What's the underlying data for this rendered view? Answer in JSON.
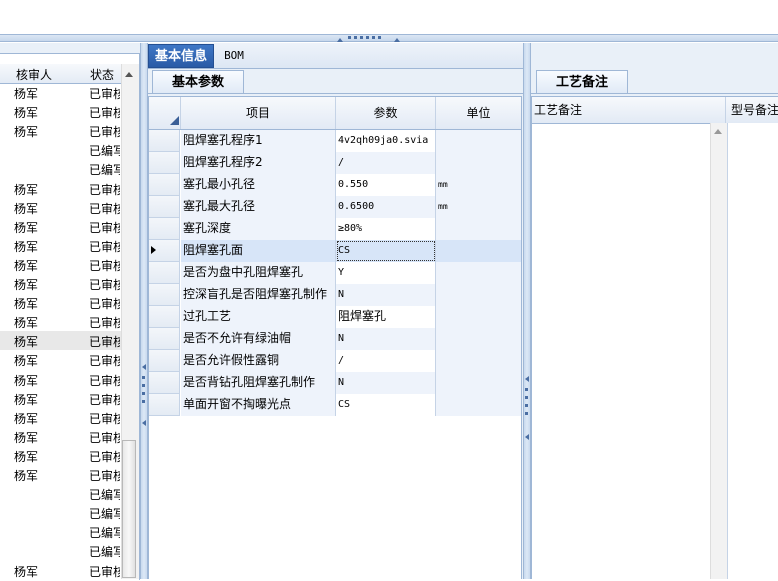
{
  "left_grid": {
    "headers": [
      "核审人",
      "状态"
    ],
    "rows": [
      {
        "reviewer": "杨军",
        "status": "已审核"
      },
      {
        "reviewer": "杨军",
        "status": "已审核"
      },
      {
        "reviewer": "杨军",
        "status": "已审核"
      },
      {
        "reviewer": "",
        "status": "已编写"
      },
      {
        "reviewer": "",
        "status": "已编写"
      },
      {
        "reviewer": "杨军",
        "status": "已审核"
      },
      {
        "reviewer": "杨军",
        "status": "已审核"
      },
      {
        "reviewer": "杨军",
        "status": "已审核"
      },
      {
        "reviewer": "杨军",
        "status": "已审核"
      },
      {
        "reviewer": "杨军",
        "status": "已审核"
      },
      {
        "reviewer": "杨军",
        "status": "已审核"
      },
      {
        "reviewer": "杨军",
        "status": "已审核"
      },
      {
        "reviewer": "杨军",
        "status": "已审核"
      },
      {
        "reviewer": "杨军",
        "status": "已审核"
      },
      {
        "reviewer": "杨军",
        "status": "已审核"
      },
      {
        "reviewer": "杨军",
        "status": "已审核"
      },
      {
        "reviewer": "杨军",
        "status": "已审核"
      },
      {
        "reviewer": "杨军",
        "status": "已审核"
      },
      {
        "reviewer": "杨军",
        "status": "已审核"
      },
      {
        "reviewer": "杨军",
        "status": "已审核"
      },
      {
        "reviewer": "杨军",
        "status": "已审核"
      },
      {
        "reviewer": "",
        "status": "已编写"
      },
      {
        "reviewer": "",
        "status": "已编写"
      },
      {
        "reviewer": "",
        "status": "已编写"
      },
      {
        "reviewer": "",
        "status": "已编写"
      },
      {
        "reviewer": "杨军",
        "status": "已审核"
      }
    ]
  },
  "tabs": {
    "basic_info": "基本信息",
    "bom": "BOM"
  },
  "center": {
    "subtab": "基本参数",
    "headers": {
      "item": "项目",
      "param": "参数",
      "unit": "单位"
    },
    "rows": [
      {
        "item": "阻焊塞孔程序1",
        "param": "4v2qh09ja0.svia",
        "unit": ""
      },
      {
        "item": "阻焊塞孔程序2",
        "param": "/",
        "unit": ""
      },
      {
        "item": "塞孔最小孔径",
        "param": "0.550",
        "unit": "mm"
      },
      {
        "item": "塞孔最大孔径",
        "param": "0.6500",
        "unit": "mm"
      },
      {
        "item": "塞孔深度",
        "param": "≥80%",
        "unit": ""
      },
      {
        "item": "阻焊塞孔面",
        "param": "CS",
        "unit": ""
      },
      {
        "item": "是否为盘中孔阻焊塞孔",
        "param": "Y",
        "unit": ""
      },
      {
        "item": "控深盲孔是否阻焊塞孔制作",
        "param": "N",
        "unit": ""
      },
      {
        "item": "过孔工艺",
        "param": "阻焊塞孔",
        "unit": ""
      },
      {
        "item": "是否不允许有绿油帽",
        "param": "N",
        "unit": ""
      },
      {
        "item": "是否允许假性露铜",
        "param": "/",
        "unit": ""
      },
      {
        "item": "是否背钻孔阻焊塞孔制作",
        "param": "N",
        "unit": ""
      },
      {
        "item": "单面开窗不掏曝光点",
        "param": "CS",
        "unit": ""
      }
    ]
  },
  "right": {
    "tab": "工艺备注",
    "headers": [
      "工艺备注",
      "型号备注"
    ]
  }
}
